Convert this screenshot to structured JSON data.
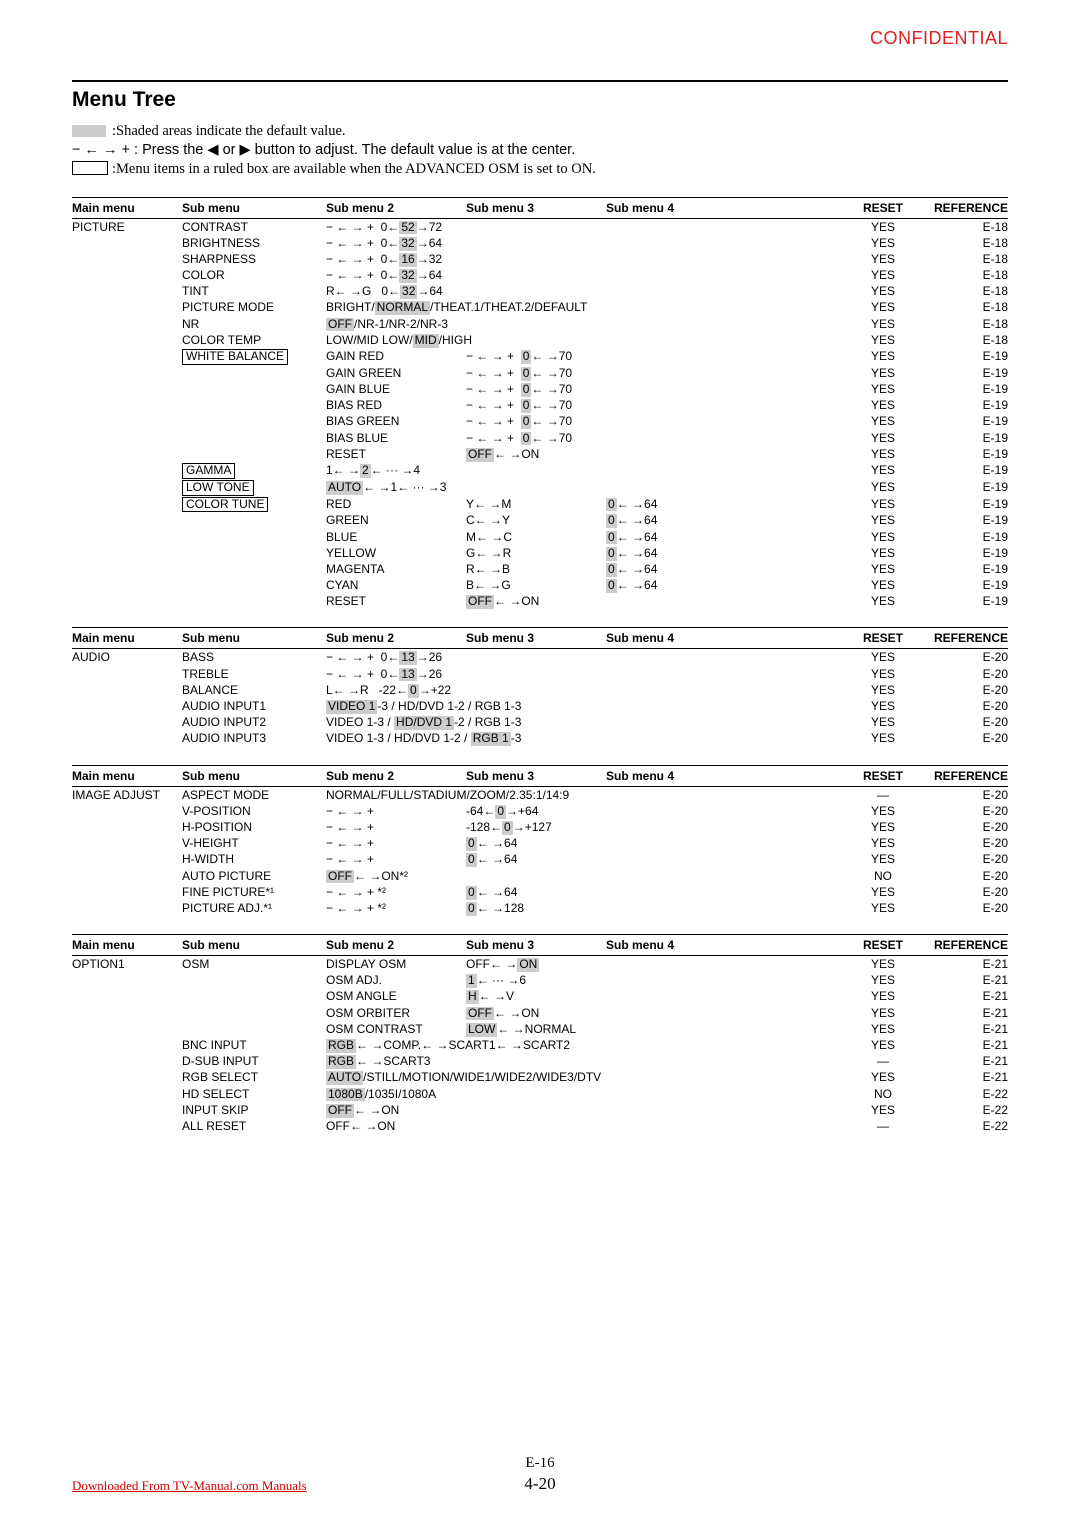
{
  "confidential": "CONFIDENTIAL",
  "intro": {
    "title": "Menu Tree",
    "shaded": ":Shaded areas indicate the default value.",
    "press": "− ← → + : Press the ◀ or ▶ button to adjust. The default value is at the center.",
    "boxed": ":Menu items in a ruled box are available when the ADVANCED OSM is set to ON."
  },
  "headers": {
    "main": "Main menu",
    "sub": "Sub menu",
    "sub2": "Sub menu 2",
    "sub3": "Sub menu 3",
    "sub4": "Sub menu 4",
    "reset": "RESET",
    "ref": "REFERENCE"
  },
  "sections": [
    {
      "main": "PICTURE",
      "rows": [
        {
          "sub": "CONTRAST",
          "sub2_segs": [
            {
              "t": "− ← → +  0←"
            },
            {
              "t": "52",
              "shade": true
            },
            {
              "t": "→72"
            }
          ],
          "reset": "YES",
          "ref": "E-18"
        },
        {
          "sub": "BRIGHTNESS",
          "sub2_segs": [
            {
              "t": "− ← → +  0←"
            },
            {
              "t": "32",
              "shade": true
            },
            {
              "t": "→64"
            }
          ],
          "reset": "YES",
          "ref": "E-18"
        },
        {
          "sub": "SHARPNESS",
          "sub2_segs": [
            {
              "t": "− ← → +  0←"
            },
            {
              "t": "16",
              "shade": true
            },
            {
              "t": "→32"
            }
          ],
          "reset": "YES",
          "ref": "E-18"
        },
        {
          "sub": "COLOR",
          "sub2_segs": [
            {
              "t": "− ← → +  0←"
            },
            {
              "t": "32",
              "shade": true
            },
            {
              "t": "→64"
            }
          ],
          "reset": "YES",
          "ref": "E-18"
        },
        {
          "sub": "TINT",
          "sub2_segs": [
            {
              "t": "R← →G   0←"
            },
            {
              "t": "32",
              "shade": true
            },
            {
              "t": "→64"
            }
          ],
          "reset": "YES",
          "ref": "E-18"
        },
        {
          "sub": "PICTURE MODE",
          "sub2_segs": [
            {
              "t": "BRIGHT/"
            },
            {
              "t": "NORMAL",
              "shade": true
            },
            {
              "t": "/THEAT.1/THEAT.2/DEFAULT"
            }
          ],
          "reset": "YES",
          "ref": "E-18"
        },
        {
          "sub": "NR",
          "sub2_segs": [
            {
              "t": "OFF",
              "shade": true
            },
            {
              "t": "/NR-1/NR-2/NR-3"
            }
          ],
          "reset": "YES",
          "ref": "E-18"
        },
        {
          "sub": "COLOR TEMP",
          "sub2_segs": [
            {
              "t": "LOW/MID LOW/"
            },
            {
              "t": "MID",
              "shade": true
            },
            {
              "t": "/HIGH"
            }
          ],
          "reset": "YES",
          "ref": "E-18"
        },
        {
          "sub": "WHITE BALANCE",
          "sub_boxed": true,
          "sub2": "GAIN RED",
          "sub3_segs": [
            {
              "t": "− ← → +  "
            },
            {
              "t": "0",
              "shade": true
            },
            {
              "t": "← →70"
            }
          ],
          "reset": "YES",
          "ref": "E-19"
        },
        {
          "sub2": "GAIN GREEN",
          "sub3_segs": [
            {
              "t": "− ← → +  "
            },
            {
              "t": "0",
              "shade": true
            },
            {
              "t": "← →70"
            }
          ],
          "reset": "YES",
          "ref": "E-19"
        },
        {
          "sub2": "GAIN BLUE",
          "sub3_segs": [
            {
              "t": "− ← → +  "
            },
            {
              "t": "0",
              "shade": true
            },
            {
              "t": "← →70"
            }
          ],
          "reset": "YES",
          "ref": "E-19"
        },
        {
          "sub2": "BIAS RED",
          "sub3_segs": [
            {
              "t": "− ← → +  "
            },
            {
              "t": "0",
              "shade": true
            },
            {
              "t": "← →70"
            }
          ],
          "reset": "YES",
          "ref": "E-19"
        },
        {
          "sub2": "BIAS GREEN",
          "sub3_segs": [
            {
              "t": "− ← → +  "
            },
            {
              "t": "0",
              "shade": true
            },
            {
              "t": "← →70"
            }
          ],
          "reset": "YES",
          "ref": "E-19"
        },
        {
          "sub2": "BIAS BLUE",
          "sub3_segs": [
            {
              "t": "− ← → +  "
            },
            {
              "t": "0",
              "shade": true
            },
            {
              "t": "← →70"
            }
          ],
          "reset": "YES",
          "ref": "E-19"
        },
        {
          "sub2": "RESET",
          "sub3_segs": [
            {
              "t": "OFF",
              "shade": true
            },
            {
              "t": "← →ON"
            }
          ],
          "reset": "YES",
          "ref": "E-19"
        },
        {
          "sub": "GAMMA",
          "sub_boxed": true,
          "sub2_segs": [
            {
              "t": "1← →"
            },
            {
              "t": "2",
              "shade": true
            },
            {
              "t": "← ··· →4"
            }
          ],
          "reset": "YES",
          "ref": "E-19"
        },
        {
          "sub": "LOW TONE",
          "sub_boxed": true,
          "sub2_segs": [
            {
              "t": "AUTO",
              "shade": true
            },
            {
              "t": "← →1← ··· →3"
            }
          ],
          "reset": "YES",
          "ref": "E-19"
        },
        {
          "sub": "COLOR TUNE",
          "sub_boxed": true,
          "sub2": "RED",
          "sub3": "Y← →M",
          "sub4_segs": [
            {
              "t": "0",
              "shade": true
            },
            {
              "t": "← →64"
            }
          ],
          "reset": "YES",
          "ref": "E-19"
        },
        {
          "sub2": "GREEN",
          "sub3": "C← →Y",
          "sub4_segs": [
            {
              "t": "0",
              "shade": true
            },
            {
              "t": "← →64"
            }
          ],
          "reset": "YES",
          "ref": "E-19"
        },
        {
          "sub2": "BLUE",
          "sub3": "M← →C",
          "sub4_segs": [
            {
              "t": "0",
              "shade": true
            },
            {
              "t": "← →64"
            }
          ],
          "reset": "YES",
          "ref": "E-19"
        },
        {
          "sub2": "YELLOW",
          "sub3": "G← →R",
          "sub4_segs": [
            {
              "t": "0",
              "shade": true
            },
            {
              "t": "← →64"
            }
          ],
          "reset": "YES",
          "ref": "E-19"
        },
        {
          "sub2": "MAGENTA",
          "sub3": "R← →B",
          "sub4_segs": [
            {
              "t": "0",
              "shade": true
            },
            {
              "t": "← →64"
            }
          ],
          "reset": "YES",
          "ref": "E-19"
        },
        {
          "sub2": "CYAN",
          "sub3": "B← →G",
          "sub4_segs": [
            {
              "t": "0",
              "shade": true
            },
            {
              "t": "← →64"
            }
          ],
          "reset": "YES",
          "ref": "E-19"
        },
        {
          "sub2": "RESET",
          "sub3_segs": [
            {
              "t": "OFF",
              "shade": true
            },
            {
              "t": "← →ON"
            }
          ],
          "reset": "YES",
          "ref": "E-19"
        }
      ]
    },
    {
      "main": "AUDIO",
      "rows": [
        {
          "sub": "BASS",
          "sub2_segs": [
            {
              "t": "− ← → +  0←"
            },
            {
              "t": "13",
              "shade": true
            },
            {
              "t": "→26"
            }
          ],
          "reset": "YES",
          "ref": "E-20"
        },
        {
          "sub": "TREBLE",
          "sub2_segs": [
            {
              "t": "− ← → +  0←"
            },
            {
              "t": "13",
              "shade": true
            },
            {
              "t": "→26"
            }
          ],
          "reset": "YES",
          "ref": "E-20"
        },
        {
          "sub": "BALANCE",
          "sub2_segs": [
            {
              "t": "L← →R   -22←"
            },
            {
              "t": "0",
              "shade": true
            },
            {
              "t": "→+22"
            }
          ],
          "reset": "YES",
          "ref": "E-20"
        },
        {
          "sub": "AUDIO INPUT1",
          "sub2_segs": [
            {
              "t": "VIDEO 1",
              "shade": true
            },
            {
              "t": "-3 / HD/DVD 1-2 / RGB 1-3"
            }
          ],
          "reset": "YES",
          "ref": "E-20"
        },
        {
          "sub": "AUDIO INPUT2",
          "sub2_segs": [
            {
              "t": "VIDEO 1-3 / "
            },
            {
              "t": "HD/DVD 1",
              "shade": true
            },
            {
              "t": "-2 / RGB 1-3"
            }
          ],
          "reset": "YES",
          "ref": "E-20"
        },
        {
          "sub": "AUDIO INPUT3",
          "sub2_segs": [
            {
              "t": "VIDEO 1-3 / HD/DVD 1-2 / "
            },
            {
              "t": "RGB 1",
              "shade": true
            },
            {
              "t": "-3"
            }
          ],
          "reset": "YES",
          "ref": "E-20"
        }
      ]
    },
    {
      "main": "IMAGE ADJUST",
      "rows": [
        {
          "sub": "ASPECT MODE",
          "sub2_segs": [
            {
              "t": "NORMAL/FULL/STADIUM/ZOOM/2.35:1/14:9"
            }
          ],
          "reset": "—",
          "ref": "E-20"
        },
        {
          "sub": "V-POSITION",
          "sub2": "− ← → +",
          "sub3_segs": [
            {
              "t": "-64←"
            },
            {
              "t": "0",
              "shade": true
            },
            {
              "t": "→+64"
            }
          ],
          "reset": "YES",
          "ref": "E-20"
        },
        {
          "sub": "H-POSITION",
          "sub2": "− ← → +",
          "sub3_segs": [
            {
              "t": "-128←"
            },
            {
              "t": "0",
              "shade": true
            },
            {
              "t": "→+127"
            }
          ],
          "reset": "YES",
          "ref": "E-20"
        },
        {
          "sub": "V-HEIGHT",
          "sub2": "− ← → +",
          "sub3_segs": [
            {
              "t": "0",
              "shade": true
            },
            {
              "t": "← →64"
            }
          ],
          "reset": "YES",
          "ref": "E-20"
        },
        {
          "sub": "H-WIDTH",
          "sub2": "− ← → +",
          "sub3_segs": [
            {
              "t": "0",
              "shade": true
            },
            {
              "t": "← →64"
            }
          ],
          "reset": "YES",
          "ref": "E-20"
        },
        {
          "sub": "AUTO PICTURE",
          "sub2_segs": [
            {
              "t": "OFF",
              "shade": true
            },
            {
              "t": "← →ON*²"
            }
          ],
          "reset": "NO",
          "ref": "E-20"
        },
        {
          "sub": "FINE PICTURE*¹",
          "sub2": "− ← → + *²",
          "sub3_segs": [
            {
              "t": "0",
              "shade": true
            },
            {
              "t": "← →64"
            }
          ],
          "reset": "YES",
          "ref": "E-20"
        },
        {
          "sub": "PICTURE ADJ.*¹",
          "sub2": "− ← → + *²",
          "sub3_segs": [
            {
              "t": "0",
              "shade": true
            },
            {
              "t": "← →128"
            }
          ],
          "reset": "YES",
          "ref": "E-20"
        }
      ]
    },
    {
      "main": "OPTION1",
      "rows": [
        {
          "sub": "OSM",
          "sub2": "DISPLAY OSM",
          "sub3_segs": [
            {
              "t": "OFF← →"
            },
            {
              "t": "ON",
              "shade": true
            }
          ],
          "reset": "YES",
          "ref": "E-21"
        },
        {
          "sub2": "OSM ADJ.",
          "sub3_segs": [
            {
              "t": "1",
              "shade": true
            },
            {
              "t": "← ··· →6"
            }
          ],
          "reset": "YES",
          "ref": "E-21"
        },
        {
          "sub2": "OSM ANGLE",
          "sub3_segs": [
            {
              "t": "H",
              "shade": true
            },
            {
              "t": "← →V"
            }
          ],
          "reset": "YES",
          "ref": "E-21"
        },
        {
          "sub2": "OSM ORBITER",
          "sub3_segs": [
            {
              "t": "OFF",
              "shade": true
            },
            {
              "t": "← →ON"
            }
          ],
          "reset": "YES",
          "ref": "E-21"
        },
        {
          "sub2": "OSM CONTRAST",
          "sub3_segs": [
            {
              "t": "LOW",
              "shade": true
            },
            {
              "t": "← →NORMAL"
            }
          ],
          "reset": "YES",
          "ref": "E-21"
        },
        {
          "sub": "BNC INPUT",
          "sub2_segs": [
            {
              "t": "RGB",
              "shade": true
            },
            {
              "t": "← →COMP.← →SCART1← →SCART2"
            }
          ],
          "reset": "YES",
          "ref": "E-21"
        },
        {
          "sub": "D-SUB INPUT",
          "sub2_segs": [
            {
              "t": "RGB",
              "shade": true
            },
            {
              "t": "← →SCART3"
            }
          ],
          "reset": "—",
          "ref": "E-21"
        },
        {
          "sub": "RGB SELECT",
          "sub2_segs": [
            {
              "t": "AUTO",
              "shade": true
            },
            {
              "t": "/STILL/MOTION/WIDE1/WIDE2/WIDE3/DTV"
            }
          ],
          "reset": "YES",
          "ref": "E-21"
        },
        {
          "sub": "HD SELECT",
          "sub2_segs": [
            {
              "t": "1080B",
              "shade": true
            },
            {
              "t": "/1035I/1080A"
            }
          ],
          "reset": "NO",
          "ref": "E-22"
        },
        {
          "sub": "INPUT SKIP",
          "sub2_segs": [
            {
              "t": "OFF",
              "shade": true
            },
            {
              "t": "← →ON"
            }
          ],
          "reset": "YES",
          "ref": "E-22"
        },
        {
          "sub": "ALL RESET",
          "sub2_segs": [
            {
              "t": "OFF← →ON"
            }
          ],
          "reset": "—",
          "ref": "E-22"
        }
      ]
    }
  ],
  "footer": {
    "e": "E-16",
    "pg": "4-20",
    "dl": "Downloaded From TV-Manual.com Manuals"
  }
}
